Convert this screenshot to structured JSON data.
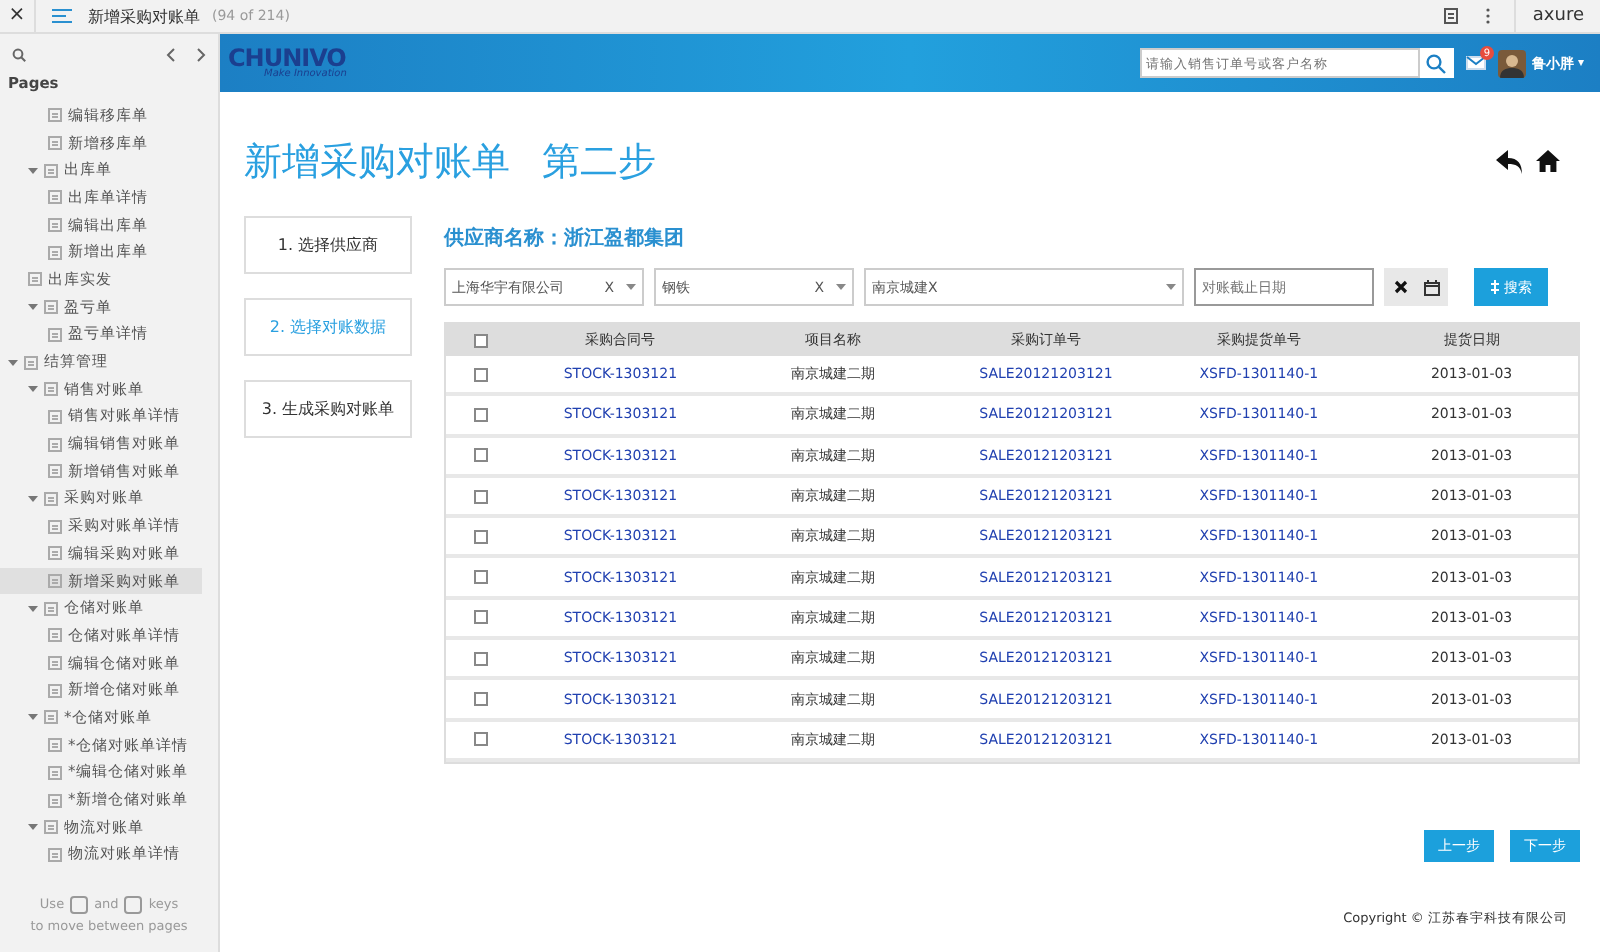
{
  "topbar": {
    "close": "×",
    "title": "新增采购对账单",
    "count": "(94 of 214)",
    "brand": "axure"
  },
  "sidebar": {
    "heading": "Pages",
    "tree": [
      {
        "children": [
          {
            "children": [
              {
                "label": "编辑移库单",
                "selected": false
              },
              {
                "label": "新增移库单",
                "selected": false
              }
            ]
          },
          {
            "label": "出库单",
            "selected": false,
            "expanded": true,
            "children": [
              {
                "label": "出库单详情",
                "selected": false
              },
              {
                "label": "编辑出库单",
                "selected": false
              },
              {
                "label": "新增出库单",
                "selected": false
              }
            ]
          },
          {
            "label": "出库实发",
            "selected": false
          },
          {
            "label": "盈亏单",
            "selected": false,
            "expanded": true,
            "children": [
              {
                "label": "盈亏单详情",
                "selected": false
              }
            ]
          }
        ]
      },
      {
        "label": "结算管理",
        "selected": false,
        "expanded": true,
        "children": [
          {
            "label": "销售对账单",
            "selected": false,
            "expanded": true,
            "children": [
              {
                "label": "销售对账单详情",
                "selected": false
              },
              {
                "label": "编辑销售对账单",
                "selected": false
              },
              {
                "label": "新增销售对账单",
                "selected": false
              }
            ]
          },
          {
            "label": "采购对账单",
            "selected": false,
            "expanded": true,
            "children": [
              {
                "label": "采购对账单详情",
                "selected": false
              },
              {
                "label": "编辑采购对账单",
                "selected": false
              },
              {
                "label": "新增采购对账单",
                "selected": true
              }
            ]
          },
          {
            "label": "仓储对账单",
            "selected": false,
            "expanded": true,
            "children": [
              {
                "label": "仓储对账单详情",
                "selected": false
              },
              {
                "label": "编辑仓储对账单",
                "selected": false
              },
              {
                "label": "新增仓储对账单",
                "selected": false
              }
            ]
          },
          {
            "label": "*仓储对账单",
            "selected": false,
            "expanded": true,
            "children": [
              {
                "label": "*仓储对账单详情",
                "selected": false
              },
              {
                "label": "*编辑仓储对账单",
                "selected": false
              },
              {
                "label": "*新增仓储对账单",
                "selected": false
              }
            ]
          },
          {
            "label": "物流对账单",
            "selected": false,
            "expanded": true,
            "children": [
              {
                "label": "物流对账单详情",
                "selected": false
              }
            ]
          }
        ]
      }
    ],
    "hint": {
      "use": "Use",
      "and": "and",
      "keys": "keys",
      "line2": "to move between pages"
    }
  },
  "header": {
    "logo": "CHUNIVO",
    "tagline": "Make Innovation",
    "search_placeholder": "请输入销售订单号或客户名称",
    "mail_badge": "9",
    "user": "鲁小胖",
    "user_caret": "▾"
  },
  "page": {
    "title": "新增采购对账单",
    "step_title": "第二步",
    "steps": [
      {
        "label": "1. 选择供应商",
        "selected": false
      },
      {
        "label": "2. 选择对账数据",
        "selected": true
      },
      {
        "label": "3. 生成采购对账单",
        "selected": false
      }
    ],
    "supplier": "供应商名称：浙江盈都集团",
    "filters": [
      {
        "kind": "select",
        "value": "上海华宇有限公司",
        "clear": "X"
      },
      {
        "kind": "select",
        "value": "钢铁",
        "clear": "X"
      },
      {
        "kind": "select",
        "value": "南京城建X"
      },
      {
        "kind": "date",
        "placeholder": "对账截止日期"
      }
    ],
    "search_button": "搜索",
    "table": {
      "select_all_checked": false,
      "columns": [
        "采购合同号",
        "项目名称",
        "采购订单号",
        "采购提货单号",
        "提货日期"
      ],
      "rows": [
        {
          "checked": false,
          "cells": [
            "STOCK-1303121",
            "南京城建二期",
            "SALE20121203121",
            "XSFD-1301140-1",
            "2013-01-03"
          ]
        },
        {
          "checked": false,
          "cells": [
            "STOCK-1303121",
            "南京城建二期",
            "SALE20121203121",
            "XSFD-1301140-1",
            "2013-01-03"
          ]
        },
        {
          "checked": false,
          "cells": [
            "STOCK-1303121",
            "南京城建二期",
            "SALE20121203121",
            "XSFD-1301140-1",
            "2013-01-03"
          ]
        },
        {
          "checked": false,
          "cells": [
            "STOCK-1303121",
            "南京城建二期",
            "SALE20121203121",
            "XSFD-1301140-1",
            "2013-01-03"
          ]
        },
        {
          "checked": false,
          "cells": [
            "STOCK-1303121",
            "南京城建二期",
            "SALE20121203121",
            "XSFD-1301140-1",
            "2013-01-03"
          ]
        },
        {
          "checked": false,
          "cells": [
            "STOCK-1303121",
            "南京城建二期",
            "SALE20121203121",
            "XSFD-1301140-1",
            "2013-01-03"
          ]
        },
        {
          "checked": false,
          "cells": [
            "STOCK-1303121",
            "南京城建二期",
            "SALE20121203121",
            "XSFD-1301140-1",
            "2013-01-03"
          ]
        },
        {
          "checked": false,
          "cells": [
            "STOCK-1303121",
            "南京城建二期",
            "SALE20121203121",
            "XSFD-1301140-1",
            "2013-01-03"
          ]
        },
        {
          "checked": false,
          "cells": [
            "STOCK-1303121",
            "南京城建二期",
            "SALE20121203121",
            "XSFD-1301140-1",
            "2013-01-03"
          ]
        },
        {
          "checked": false,
          "cells": [
            "STOCK-1303121",
            "南京城建二期",
            "SALE20121203121",
            "XSFD-1301140-1",
            "2013-01-03"
          ]
        }
      ]
    },
    "buttons": [
      "上一步",
      "下一步"
    ],
    "copyright": "Copyright © 江苏春宇科技有限公司"
  }
}
